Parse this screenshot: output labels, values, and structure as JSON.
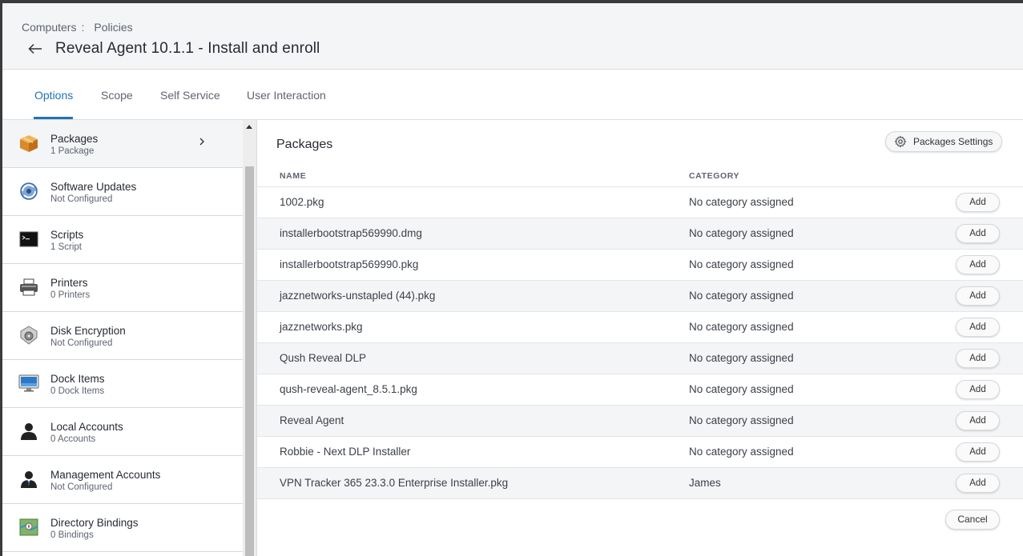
{
  "header": {
    "breadcrumb": {
      "parent": "Computers",
      "separator": ":",
      "current": "Policies"
    },
    "title": "Reveal Agent 10.1.1 - Install and enroll"
  },
  "tabs": [
    {
      "label": "Options",
      "active": true
    },
    {
      "label": "Scope",
      "active": false
    },
    {
      "label": "Self Service",
      "active": false
    },
    {
      "label": "User Interaction",
      "active": false
    }
  ],
  "sidebar": {
    "items": [
      {
        "title": "Packages",
        "subtitle": "1 Package",
        "icon": "package-box-icon",
        "active": true
      },
      {
        "title": "Software Updates",
        "subtitle": "Not Configured",
        "icon": "software-update-globe-icon"
      },
      {
        "title": "Scripts",
        "subtitle": "1 Script",
        "icon": "terminal-icon"
      },
      {
        "title": "Printers",
        "subtitle": "0 Printers",
        "icon": "printer-icon"
      },
      {
        "title": "Disk Encryption",
        "subtitle": "Not Configured",
        "icon": "disk-lock-icon"
      },
      {
        "title": "Dock Items",
        "subtitle": "0 Dock Items",
        "icon": "monitor-icon"
      },
      {
        "title": "Local Accounts",
        "subtitle": "0 Accounts",
        "icon": "user-silhouette-icon"
      },
      {
        "title": "Management Accounts",
        "subtitle": "Not Configured",
        "icon": "admin-user-icon"
      },
      {
        "title": "Directory Bindings",
        "subtitle": "0 Bindings",
        "icon": "directory-map-icon"
      }
    ]
  },
  "main": {
    "title": "Packages",
    "settings_button": "Packages Settings",
    "columns": {
      "name": "NAME",
      "category": "CATEGORY"
    },
    "add_label": "Add",
    "rows": [
      {
        "name": "1002.pkg",
        "category": "No category assigned"
      },
      {
        "name": "installerbootstrap569990.dmg",
        "category": "No category assigned"
      },
      {
        "name": "installerbootstrap569990.pkg",
        "category": "No category assigned"
      },
      {
        "name": "jazznetworks-unstapled (44).pkg",
        "category": "No category assigned"
      },
      {
        "name": "jazznetworks.pkg",
        "category": "No category assigned"
      },
      {
        "name": "Qush Reveal DLP",
        "category": "No category assigned"
      },
      {
        "name": "qush-reveal-agent_8.5.1.pkg",
        "category": "No category assigned"
      },
      {
        "name": "Reveal Agent",
        "category": "No category assigned"
      },
      {
        "name": "Robbie - Next DLP Installer",
        "category": "No category assigned"
      },
      {
        "name": "VPN Tracker 365 23.3.0 Enterprise Installer.pkg",
        "category": "James"
      }
    ],
    "cancel_label": "Cancel"
  },
  "colors": {
    "accent": "#1f73b7",
    "header_bg": "#f4f5f7",
    "row_alt_bg": "#f4f5f7",
    "text": "#262b33",
    "muted": "#5e6470"
  }
}
